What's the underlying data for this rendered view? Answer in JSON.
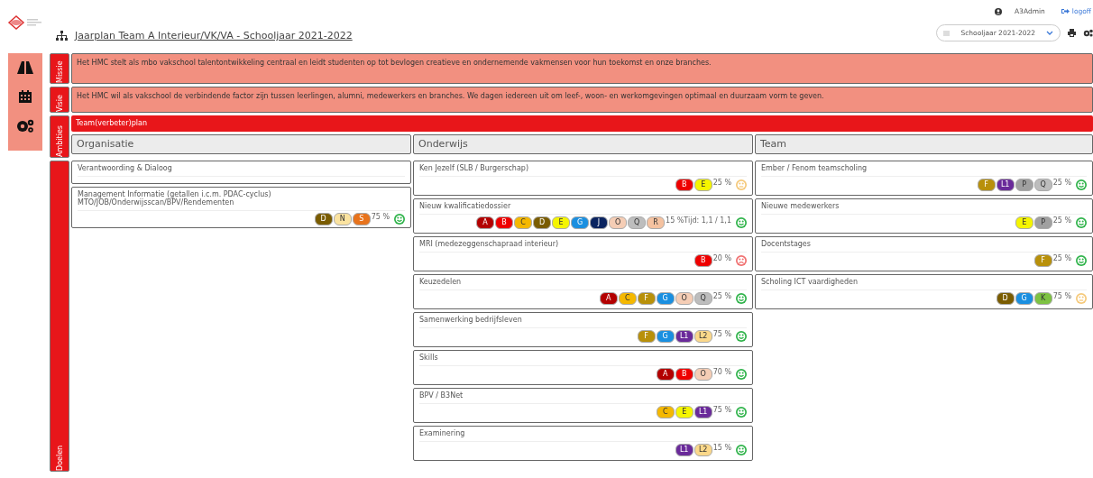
{
  "user": {
    "name": "A3Admin",
    "logoff": "logoff"
  },
  "title": "Jaarplan Team A Interieur/VK/VA - Schooljaar 2021-2022",
  "year_select": {
    "value": "Schooljaar 2021-2022"
  },
  "sections": [
    {
      "label": "Missie",
      "text": "Het HMC stelt als mbo vakschool talentontwikkeling centraal en leidt studenten op tot bevlogen creatieve en ondernemende vakmensen voor hun toekomst en onze branches."
    },
    {
      "label": "Visie",
      "text": "Het HMC wil als vakschool de verbindende factor zijn tussen leerlingen, alumni, medewerkers en branches. We dagen iedereen uit om leef-, woon- en werkomgevingen optimaal en duurzaam vorm te geven."
    }
  ],
  "ambities": {
    "label": "Ambities",
    "plan": "Team(verbeter)plan",
    "columns": [
      "Organisatie",
      "Onderwijs",
      "Team"
    ]
  },
  "doelen": {
    "label": "Doelen",
    "columns": [
      [
        {
          "title": "Verantwoording & Dialoog"
        },
        {
          "title": "Management Informatie (getallen i.c.m. PDAC-cyclus) MTO/JOB/Onderwijsscan/BPV/Rendementen",
          "badges": [
            {
              "label": "D",
              "color": "#7a5c00"
            },
            {
              "label": "N",
              "color": "#fbe3a0"
            },
            {
              "label": "S",
              "color": "#e8731c"
            }
          ],
          "percent": "75 %",
          "smiley": {
            "kind": "happy",
            "color": "#2fb34a"
          }
        }
      ],
      [
        {
          "title": "Ken Jezelf (SLB / Burgerschap)",
          "badges": [
            {
              "label": "B",
              "color": "#ee0000"
            },
            {
              "label": "E",
              "color": "#f5f500"
            }
          ],
          "percent": "25 %",
          "smiley": {
            "kind": "neutral",
            "color": "#f5c97a"
          }
        },
        {
          "title": "Nieuw kwalificatiedossier",
          "badges": [
            {
              "label": "A",
              "color": "#b30000"
            },
            {
              "label": "B",
              "color": "#ee0000"
            },
            {
              "label": "C",
              "color": "#f5b800"
            },
            {
              "label": "D",
              "color": "#7a5c00"
            },
            {
              "label": "E",
              "color": "#f5f500"
            },
            {
              "label": "G",
              "color": "#1a8fe0"
            },
            {
              "label": "J",
              "color": "#0a2460"
            },
            {
              "label": "O",
              "color": "#f5cdb5"
            },
            {
              "label": "Q",
              "color": "#bdbdbd"
            },
            {
              "label": "R",
              "color": "#f5c2a0"
            }
          ],
          "percent": "15 %Tijd: 1,1 / 1,1",
          "smiley": {
            "kind": "happy",
            "color": "#2fb34a"
          }
        },
        {
          "title": "MRI (medezeggenschapraad interieur)",
          "badges": [
            {
              "label": "B",
              "color": "#ee0000"
            }
          ],
          "percent": "20 %",
          "smiley": {
            "kind": "sad",
            "color": "#f07070"
          }
        },
        {
          "title": "Keuzedelen",
          "badges": [
            {
              "label": "A",
              "color": "#b30000"
            },
            {
              "label": "C",
              "color": "#f5b800"
            },
            {
              "label": "F",
              "color": "#b8900a"
            },
            {
              "label": "G",
              "color": "#1a8fe0"
            },
            {
              "label": "O",
              "color": "#f5cdb5"
            },
            {
              "label": "Q",
              "color": "#bdbdbd"
            }
          ],
          "percent": "25 %",
          "smiley": {
            "kind": "happy",
            "color": "#2fb34a"
          }
        },
        {
          "title": "Samenwerking bedrijfsleven",
          "badges": [
            {
              "label": "F",
              "color": "#b8900a"
            },
            {
              "label": "G",
              "color": "#1a8fe0"
            },
            {
              "label": "L1",
              "color": "#6a2a9a"
            },
            {
              "label": "L2",
              "color": "#fbd88a"
            }
          ],
          "percent": "75 %",
          "smiley": {
            "kind": "happy",
            "color": "#2fb34a"
          }
        },
        {
          "title": "Skills",
          "badges": [
            {
              "label": "A",
              "color": "#b30000"
            },
            {
              "label": "B",
              "color": "#ee0000"
            },
            {
              "label": "O",
              "color": "#f5cdb5"
            }
          ],
          "percent": "70 %",
          "smiley": {
            "kind": "happy",
            "color": "#2fb34a"
          }
        },
        {
          "title": "BPV / B3Net",
          "badges": [
            {
              "label": "C",
              "color": "#f5b800"
            },
            {
              "label": "E",
              "color": "#f5f500"
            },
            {
              "label": "L1",
              "color": "#6a2a9a"
            }
          ],
          "percent": "75 %",
          "smiley": {
            "kind": "happy",
            "color": "#2fb34a"
          }
        },
        {
          "title": "Examinering",
          "badges": [
            {
              "label": "L1",
              "color": "#6a2a9a"
            },
            {
              "label": "L2",
              "color": "#fbd88a"
            }
          ],
          "percent": "15 %",
          "smiley": {
            "kind": "happy",
            "color": "#2fb34a"
          }
        }
      ],
      [
        {
          "title": "Ember / Fenom teamscholing",
          "badges": [
            {
              "label": "F",
              "color": "#b8900a"
            },
            {
              "label": "L1",
              "color": "#6a2a9a"
            },
            {
              "label": "P",
              "color": "#a0a0a0"
            },
            {
              "label": "Q",
              "color": "#bdbdbd"
            }
          ],
          "percent": "25 %",
          "smiley": {
            "kind": "happy",
            "color": "#2fb34a"
          }
        },
        {
          "title": "Nieuwe medewerkers",
          "badges": [
            {
              "label": "E",
              "color": "#f5f500"
            },
            {
              "label": "P",
              "color": "#a0a0a0"
            }
          ],
          "percent": "25 %",
          "smiley": {
            "kind": "happy",
            "color": "#2fb34a"
          }
        },
        {
          "title": "Docentstages",
          "badges": [
            {
              "label": "F",
              "color": "#b8900a"
            }
          ],
          "percent": "25 %",
          "smiley": {
            "kind": "happy",
            "color": "#2fb34a"
          }
        },
        {
          "title": "Scholing ICT vaardigheden",
          "badges": [
            {
              "label": "D",
              "color": "#7a5c00"
            },
            {
              "label": "G",
              "color": "#1a8fe0"
            },
            {
              "label": "K",
              "color": "#7dc242"
            }
          ],
          "percent": "75 %",
          "smiley": {
            "kind": "neutral",
            "color": "#f5c97a"
          }
        }
      ]
    ]
  }
}
